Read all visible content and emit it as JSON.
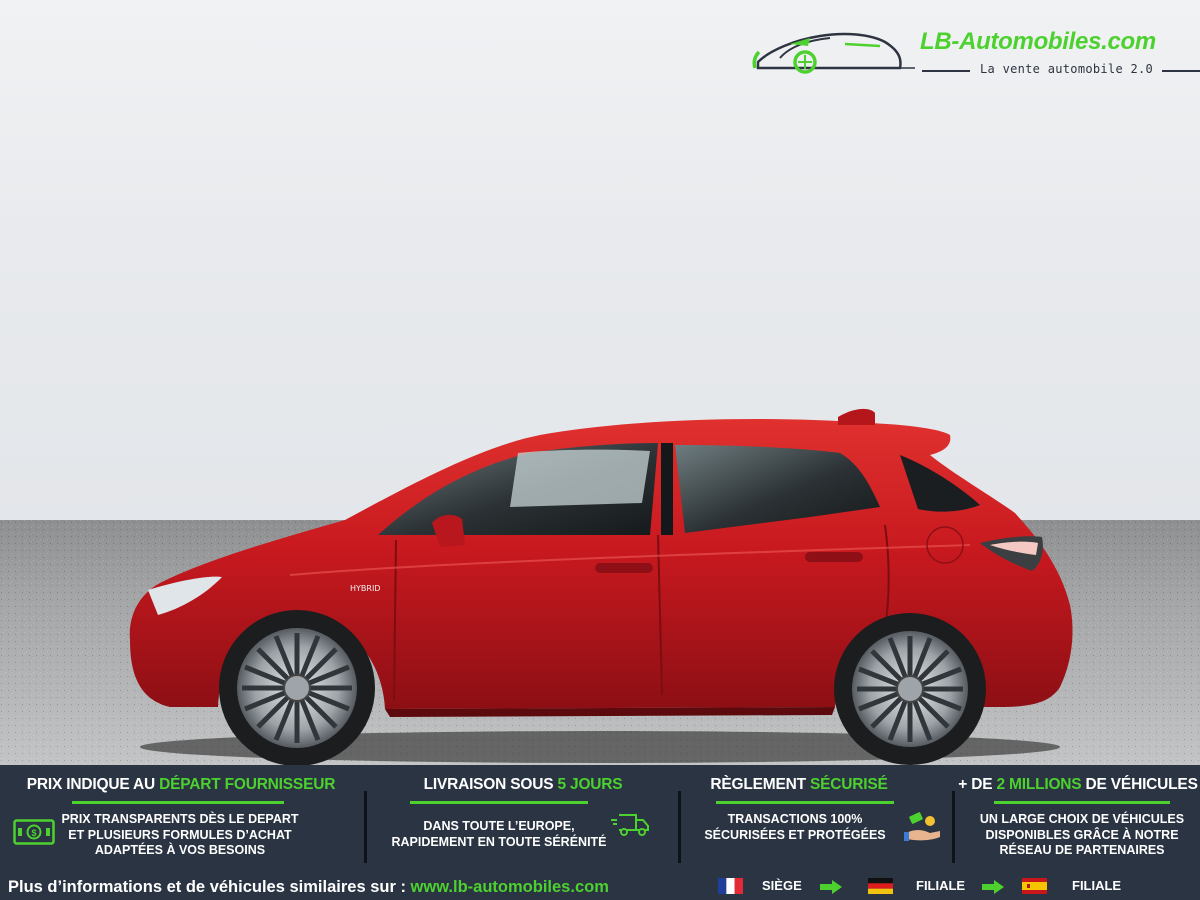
{
  "logo": {
    "brand": "LB-Automobiles.com",
    "tagline": "La vente automobile 2.0",
    "icon": "car-silhouette-icon"
  },
  "vehicle": {
    "badge": "HYBRID",
    "color": "#c8191f"
  },
  "banner": {
    "col1": {
      "title_pre": "PRIX INDIQUE AU ",
      "title_hl": "DÉPART FOURNISSEUR",
      "line1": "PRIX TRANSPARENTS DÈS LE DEPART",
      "line2": "ET PLUSIEURS FORMULES D’ACHAT",
      "line3": "ADAPTÉES À VOS BESOINS",
      "icon": "money-bill-icon"
    },
    "col2": {
      "title_pre": "LIVRAISON SOUS ",
      "title_hl": "5 JOURS",
      "line1": "DANS TOUTE L’EUROPE,",
      "line2": "RAPIDEMENT EN TOUTE SÉRÉNITÉ",
      "icon": "delivery-truck-icon"
    },
    "col3": {
      "title_pre": "RÈGLEMENT ",
      "title_hl": "SÉCURISÉ",
      "line1": "TRANSACTIONS 100%",
      "line2": "SÉCURISÉES ET PROTÉGÉES",
      "icon": "payment-hand-icon"
    },
    "col4": {
      "title_pre": "+ DE ",
      "title_hl": "2 MILLIONS",
      "title_post": " DE VÉHICULES",
      "line1": "UN LARGE CHOIX DE VÉHICULES",
      "line2": "DISPONIBLES GRÂCE À NOTRE",
      "line3": "RÉSEAU DE PARTENAIRES"
    },
    "footer": {
      "text": "Plus d’informations et de véhicules similaires sur : ",
      "url": "www.lb-automobiles.com",
      "locations": [
        {
          "flag": "france-flag-icon",
          "label": "SIÈGE"
        },
        {
          "flag": "germany-flag-icon",
          "label": "FILIALE"
        },
        {
          "flag": "spain-flag-icon",
          "label": "FILIALE"
        }
      ]
    }
  },
  "colors": {
    "accent": "#4cd12e",
    "banner_bg": "#2b3443",
    "logo_text": "#2e3540"
  }
}
